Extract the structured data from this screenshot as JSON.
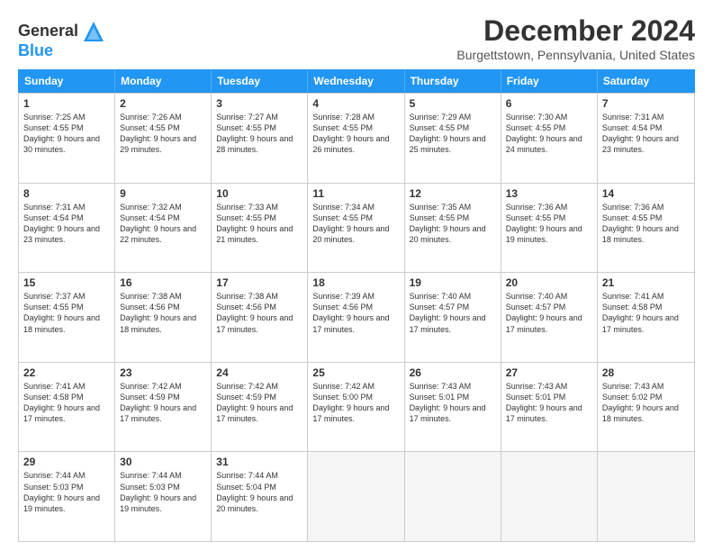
{
  "header": {
    "logo_line1": "General",
    "logo_line2": "Blue",
    "month": "December 2024",
    "location": "Burgettstown, Pennsylvania, United States"
  },
  "weekdays": [
    "Sunday",
    "Monday",
    "Tuesday",
    "Wednesday",
    "Thursday",
    "Friday",
    "Saturday"
  ],
  "rows": [
    [
      {
        "day": "1",
        "sunrise": "Sunrise: 7:25 AM",
        "sunset": "Sunset: 4:55 PM",
        "daylight": "Daylight: 9 hours and 30 minutes."
      },
      {
        "day": "2",
        "sunrise": "Sunrise: 7:26 AM",
        "sunset": "Sunset: 4:55 PM",
        "daylight": "Daylight: 9 hours and 29 minutes."
      },
      {
        "day": "3",
        "sunrise": "Sunrise: 7:27 AM",
        "sunset": "Sunset: 4:55 PM",
        "daylight": "Daylight: 9 hours and 28 minutes."
      },
      {
        "day": "4",
        "sunrise": "Sunrise: 7:28 AM",
        "sunset": "Sunset: 4:55 PM",
        "daylight": "Daylight: 9 hours and 26 minutes."
      },
      {
        "day": "5",
        "sunrise": "Sunrise: 7:29 AM",
        "sunset": "Sunset: 4:55 PM",
        "daylight": "Daylight: 9 hours and 25 minutes."
      },
      {
        "day": "6",
        "sunrise": "Sunrise: 7:30 AM",
        "sunset": "Sunset: 4:55 PM",
        "daylight": "Daylight: 9 hours and 24 minutes."
      },
      {
        "day": "7",
        "sunrise": "Sunrise: 7:31 AM",
        "sunset": "Sunset: 4:54 PM",
        "daylight": "Daylight: 9 hours and 23 minutes."
      }
    ],
    [
      {
        "day": "8",
        "sunrise": "Sunrise: 7:31 AM",
        "sunset": "Sunset: 4:54 PM",
        "daylight": "Daylight: 9 hours and 23 minutes."
      },
      {
        "day": "9",
        "sunrise": "Sunrise: 7:32 AM",
        "sunset": "Sunset: 4:54 PM",
        "daylight": "Daylight: 9 hours and 22 minutes."
      },
      {
        "day": "10",
        "sunrise": "Sunrise: 7:33 AM",
        "sunset": "Sunset: 4:55 PM",
        "daylight": "Daylight: 9 hours and 21 minutes."
      },
      {
        "day": "11",
        "sunrise": "Sunrise: 7:34 AM",
        "sunset": "Sunset: 4:55 PM",
        "daylight": "Daylight: 9 hours and 20 minutes."
      },
      {
        "day": "12",
        "sunrise": "Sunrise: 7:35 AM",
        "sunset": "Sunset: 4:55 PM",
        "daylight": "Daylight: 9 hours and 20 minutes."
      },
      {
        "day": "13",
        "sunrise": "Sunrise: 7:36 AM",
        "sunset": "Sunset: 4:55 PM",
        "daylight": "Daylight: 9 hours and 19 minutes."
      },
      {
        "day": "14",
        "sunrise": "Sunrise: 7:36 AM",
        "sunset": "Sunset: 4:55 PM",
        "daylight": "Daylight: 9 hours and 18 minutes."
      }
    ],
    [
      {
        "day": "15",
        "sunrise": "Sunrise: 7:37 AM",
        "sunset": "Sunset: 4:55 PM",
        "daylight": "Daylight: 9 hours and 18 minutes."
      },
      {
        "day": "16",
        "sunrise": "Sunrise: 7:38 AM",
        "sunset": "Sunset: 4:56 PM",
        "daylight": "Daylight: 9 hours and 18 minutes."
      },
      {
        "day": "17",
        "sunrise": "Sunrise: 7:38 AM",
        "sunset": "Sunset: 4:56 PM",
        "daylight": "Daylight: 9 hours and 17 minutes."
      },
      {
        "day": "18",
        "sunrise": "Sunrise: 7:39 AM",
        "sunset": "Sunset: 4:56 PM",
        "daylight": "Daylight: 9 hours and 17 minutes."
      },
      {
        "day": "19",
        "sunrise": "Sunrise: 7:40 AM",
        "sunset": "Sunset: 4:57 PM",
        "daylight": "Daylight: 9 hours and 17 minutes."
      },
      {
        "day": "20",
        "sunrise": "Sunrise: 7:40 AM",
        "sunset": "Sunset: 4:57 PM",
        "daylight": "Daylight: 9 hours and 17 minutes."
      },
      {
        "day": "21",
        "sunrise": "Sunrise: 7:41 AM",
        "sunset": "Sunset: 4:58 PM",
        "daylight": "Daylight: 9 hours and 17 minutes."
      }
    ],
    [
      {
        "day": "22",
        "sunrise": "Sunrise: 7:41 AM",
        "sunset": "Sunset: 4:58 PM",
        "daylight": "Daylight: 9 hours and 17 minutes."
      },
      {
        "day": "23",
        "sunrise": "Sunrise: 7:42 AM",
        "sunset": "Sunset: 4:59 PM",
        "daylight": "Daylight: 9 hours and 17 minutes."
      },
      {
        "day": "24",
        "sunrise": "Sunrise: 7:42 AM",
        "sunset": "Sunset: 4:59 PM",
        "daylight": "Daylight: 9 hours and 17 minutes."
      },
      {
        "day": "25",
        "sunrise": "Sunrise: 7:42 AM",
        "sunset": "Sunset: 5:00 PM",
        "daylight": "Daylight: 9 hours and 17 minutes."
      },
      {
        "day": "26",
        "sunrise": "Sunrise: 7:43 AM",
        "sunset": "Sunset: 5:01 PM",
        "daylight": "Daylight: 9 hours and 17 minutes."
      },
      {
        "day": "27",
        "sunrise": "Sunrise: 7:43 AM",
        "sunset": "Sunset: 5:01 PM",
        "daylight": "Daylight: 9 hours and 17 minutes."
      },
      {
        "day": "28",
        "sunrise": "Sunrise: 7:43 AM",
        "sunset": "Sunset: 5:02 PM",
        "daylight": "Daylight: 9 hours and 18 minutes."
      }
    ],
    [
      {
        "day": "29",
        "sunrise": "Sunrise: 7:44 AM",
        "sunset": "Sunset: 5:03 PM",
        "daylight": "Daylight: 9 hours and 19 minutes."
      },
      {
        "day": "30",
        "sunrise": "Sunrise: 7:44 AM",
        "sunset": "Sunset: 5:03 PM",
        "daylight": "Daylight: 9 hours and 19 minutes."
      },
      {
        "day": "31",
        "sunrise": "Sunrise: 7:44 AM",
        "sunset": "Sunset: 5:04 PM",
        "daylight": "Daylight: 9 hours and 20 minutes."
      },
      {
        "day": "",
        "sunrise": "",
        "sunset": "",
        "daylight": ""
      },
      {
        "day": "",
        "sunrise": "",
        "sunset": "",
        "daylight": ""
      },
      {
        "day": "",
        "sunrise": "",
        "sunset": "",
        "daylight": ""
      },
      {
        "day": "",
        "sunrise": "",
        "sunset": "",
        "daylight": ""
      }
    ]
  ]
}
